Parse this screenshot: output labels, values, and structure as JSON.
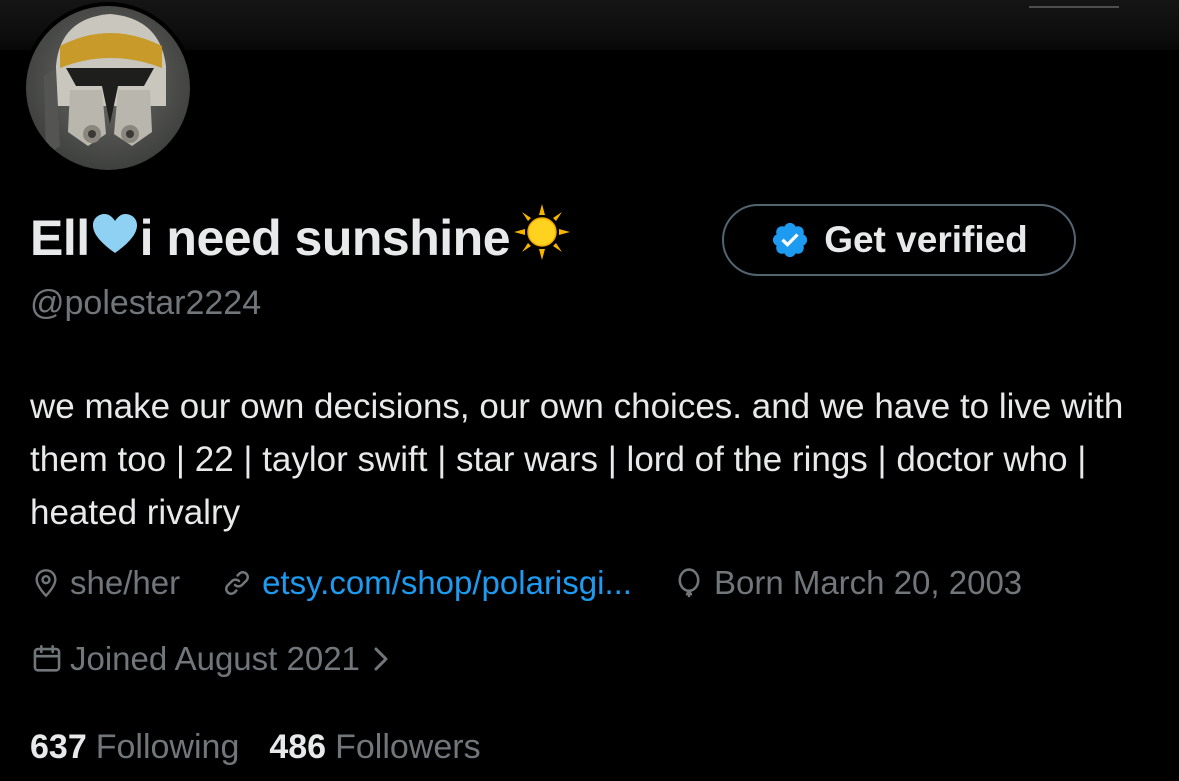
{
  "profile": {
    "name_part1": "Ell",
    "name_part2": "i need sunshine",
    "name_emojis": [
      "light-blue-heart",
      "sun"
    ],
    "handle": "@polestar2224",
    "bio": "we make our own decisions, our own choices. and we have to live with them too | 22 | taylor swift | star wars | lord of the rings | doctor who | heated rivalry",
    "pronouns": "she/her",
    "website": "etsy.com/shop/polarisgi...",
    "birthday": "Born March 20, 2003",
    "joined": "Joined August 2021"
  },
  "actions": {
    "verify_label": "Get verified"
  },
  "stats": {
    "following_count": "637",
    "following_label": "Following",
    "followers_count": "486",
    "followers_label": "Followers"
  },
  "colors": {
    "background": "#000000",
    "text_primary": "#e7e9ea",
    "text_secondary": "#71767b",
    "link": "#1d9bf0",
    "verified_badge": "#1d9bf0",
    "button_border": "#536471"
  },
  "icons": [
    "location-icon",
    "link-icon",
    "balloon-icon",
    "calendar-icon",
    "chevron-right-icon",
    "verified-badge-icon"
  ]
}
